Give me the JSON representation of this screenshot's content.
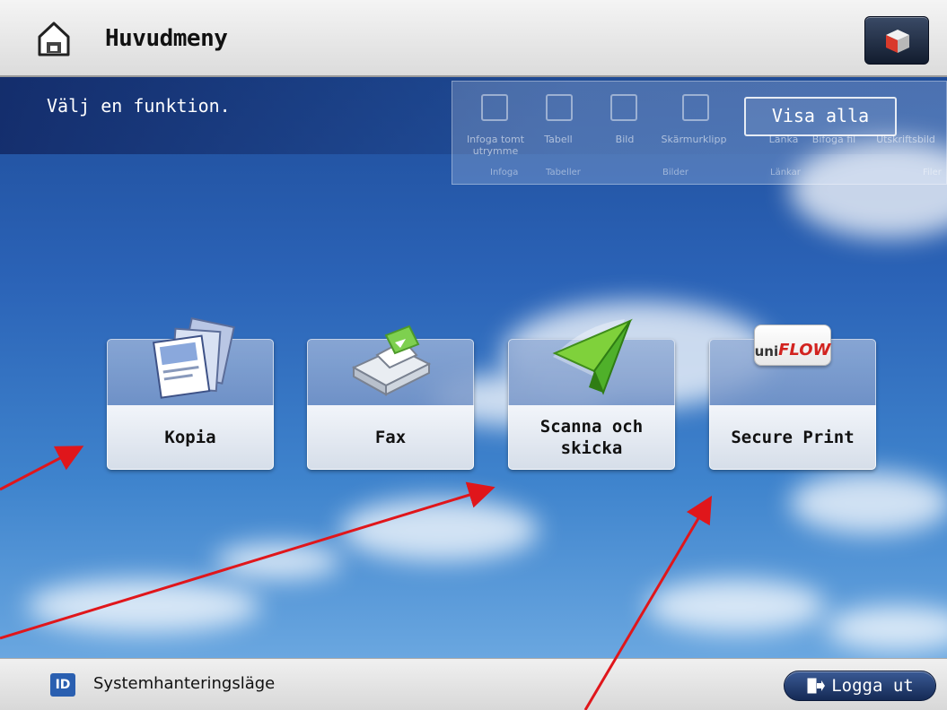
{
  "header": {
    "title": "Huvudmeny",
    "home_icon": "home-icon",
    "settings_icon": "cube-icon"
  },
  "main": {
    "prompt": "Välj en funktion.",
    "show_all_label": "Visa alla",
    "background_ribbon": {
      "items": [
        "Infoga tomt utrymme",
        "Tabell",
        "Bild",
        "Skärmurklipp",
        "Länka",
        "Bifoga fil",
        "Utskriftsbild"
      ],
      "groups": [
        "Infoga",
        "Tabeller",
        "Bilder",
        "Länkar",
        "Filer"
      ]
    },
    "tiles": [
      {
        "label": "Kopia",
        "icon": "copy-documents-icon"
      },
      {
        "label": "Fax",
        "icon": "fax-machine-icon"
      },
      {
        "label": "Scanna och skicka",
        "icon": "paper-plane-icon"
      },
      {
        "label": "Secure Print",
        "icon": "uniflow-logo",
        "logo_text_a": "uni",
        "logo_text_b": "FLOW"
      }
    ]
  },
  "footer": {
    "id_badge": "ID",
    "system_mode_label": "Systemhanteringsläge",
    "logout_label": "Logga ut",
    "logout_icon": "logout-door-icon"
  },
  "colors": {
    "annotation_arrow": "#e0161b",
    "sky_top": "#1f4d9a",
    "sky_bottom": "#6aa7e0"
  }
}
